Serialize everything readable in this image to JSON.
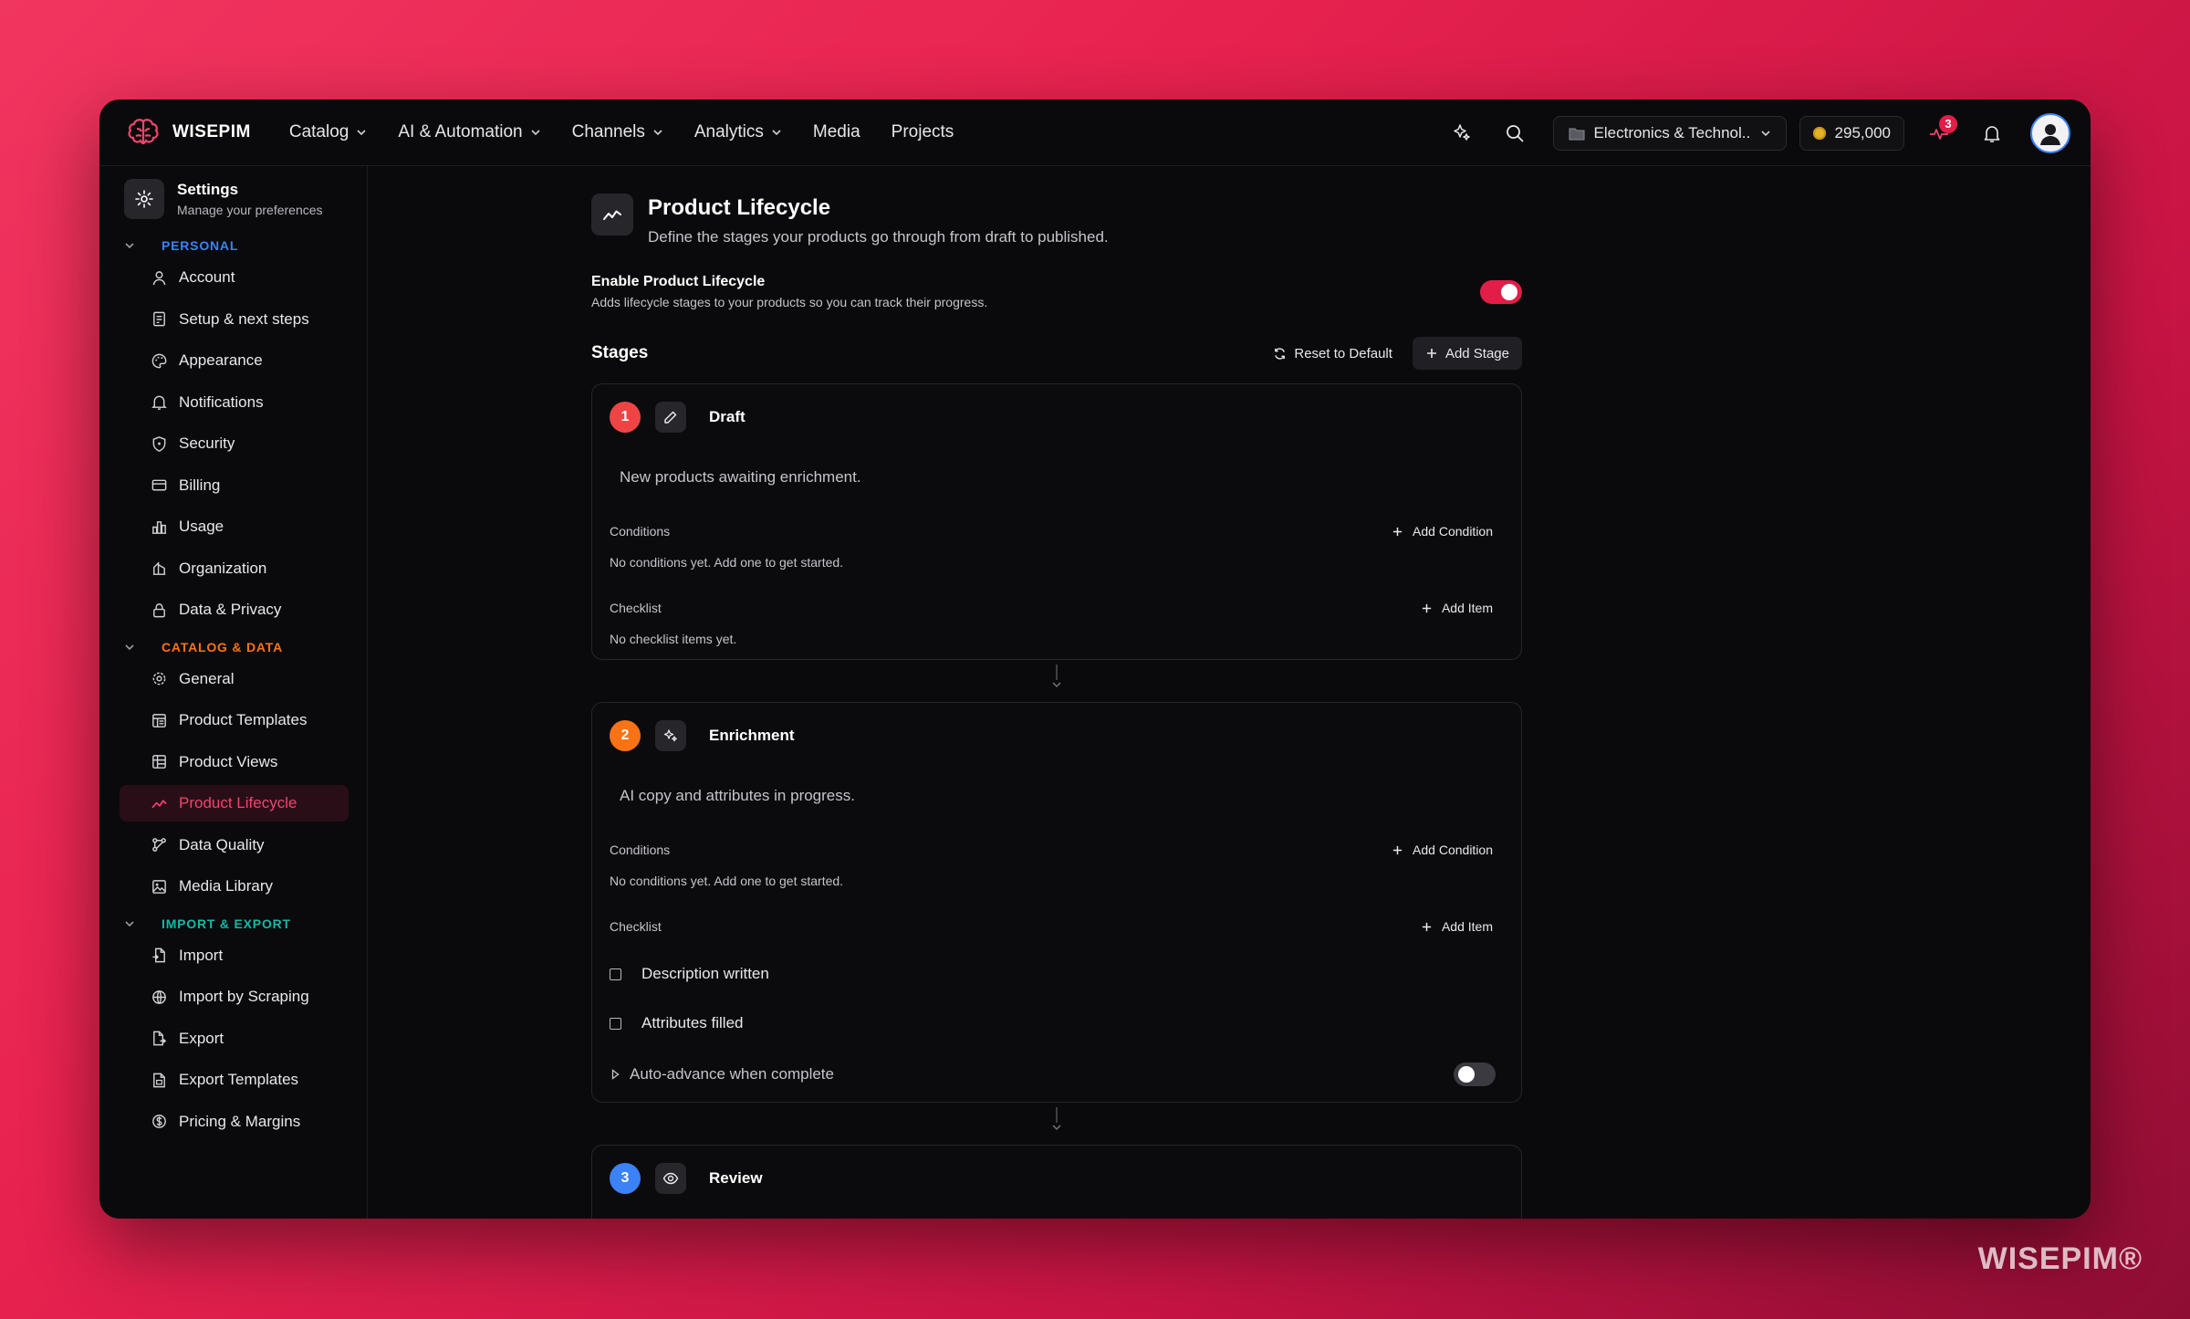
{
  "brand": {
    "name": "WISEPIM",
    "logo_icon": "brain-logo-icon"
  },
  "nav": [
    {
      "label": "Catalog",
      "has_dropdown": true
    },
    {
      "label": "AI & Automation",
      "has_dropdown": true
    },
    {
      "label": "Channels",
      "has_dropdown": true
    },
    {
      "label": "Analytics",
      "has_dropdown": true
    },
    {
      "label": "Media",
      "has_dropdown": false
    },
    {
      "label": "Projects",
      "has_dropdown": false
    }
  ],
  "topbar": {
    "org_select": "Electronics & Technol...",
    "credits": "295,000",
    "activity_badge": "3"
  },
  "sidebar": {
    "title": "Settings",
    "subtitle": "Manage your preferences",
    "sections": [
      {
        "label": "PERSONAL",
        "color": "#3b82f6",
        "items": [
          "Account",
          "Setup & next steps",
          "Appearance",
          "Notifications",
          "Security",
          "Billing",
          "Usage",
          "Organization",
          "Data & Privacy"
        ]
      },
      {
        "label": "CATALOG & DATA",
        "color": "#f97316",
        "items": [
          "General",
          "Product Templates",
          "Product Views",
          "Product Lifecycle",
          "Data Quality",
          "Media Library"
        ]
      },
      {
        "label": "IMPORT & EXPORT",
        "color": "#14b8a6",
        "items": [
          "Import",
          "Import by Scraping",
          "Export",
          "Export Templates",
          "Pricing & Margins"
        ]
      }
    ],
    "active_item": "Product Lifecycle"
  },
  "page": {
    "title": "Product Lifecycle",
    "subtitle": "Define the stages your products go through from draft to published.",
    "enable_title": "Enable Product Lifecycle",
    "enable_sub": "Adds lifecycle stages to your products so you can track their progress.",
    "enable_on": true,
    "stages_title": "Stages",
    "reset_label": "Reset to Default",
    "add_stage_label": "Add Stage"
  },
  "stages": [
    {
      "number": "1",
      "color": "#ef4444",
      "icon": "pencil-icon",
      "name": "Draft",
      "description": "New products awaiting enrichment.",
      "conditions_label": "Conditions",
      "add_condition": "Add Condition",
      "conditions_empty": "No conditions yet. Add one to get started.",
      "checklist_label": "Checklist",
      "add_item": "Add Item",
      "checklist_empty": "No checklist items yet."
    },
    {
      "number": "2",
      "color": "#f97316",
      "icon": "sparkles-icon",
      "name": "Enrichment",
      "description": "AI copy and attributes in progress.",
      "conditions_label": "Conditions",
      "add_condition": "Add Condition",
      "conditions_empty": "No conditions yet. Add one to get started.",
      "checklist_label": "Checklist",
      "add_item": "Add Item",
      "checklist": [
        "Description written",
        "Attributes filled"
      ],
      "auto_advance": "Auto-advance when complete",
      "auto_advance_on": false
    },
    {
      "number": "3",
      "color": "#3b82f6",
      "icon": "eye-icon",
      "name": "Review"
    }
  ],
  "watermark": "WISEPIM®"
}
